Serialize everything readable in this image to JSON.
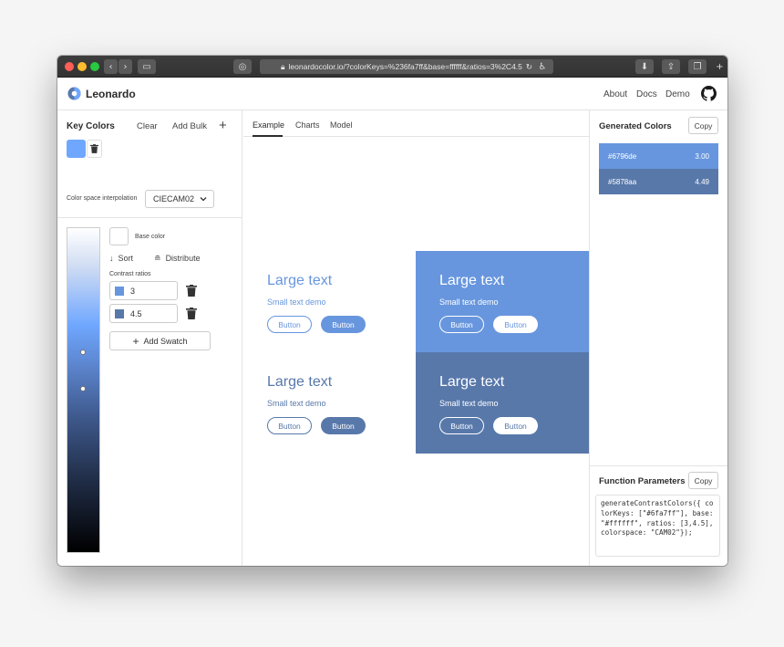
{
  "browser": {
    "url": "leonardocolor.io/?colorKeys=%236fa7ff&base=ffffff&ratios=3%2C4.5"
  },
  "app": {
    "brand": "Leonardo",
    "nav": [
      "About",
      "Docs",
      "Demo"
    ]
  },
  "left_panel": {
    "key_colors_title": "Key Colors",
    "clear_label": "Clear",
    "add_bulk_label": "Add Bulk",
    "add_icon": "+",
    "key_color": "#6fa7ff",
    "interpolation_label": "Color space interpolation",
    "interpolation_value": "CIECAM02",
    "base_color_label": "Base color",
    "sort_label": "Sort",
    "distribute_label": "Distribute",
    "contrast_ratios_label": "Contrast ratios",
    "ratios": [
      {
        "value": "3",
        "color": "#6796de"
      },
      {
        "value": "4.5",
        "color": "#5878aa"
      }
    ],
    "add_swatch_label": "Add Swatch"
  },
  "tabs": [
    "Example",
    "Charts",
    "Model"
  ],
  "demos": [
    {
      "big": "Large text",
      "small": "Small text demo",
      "btn1": "Button",
      "btn2": "Button",
      "bg": "#ffffff",
      "text_color": "#6796de"
    },
    {
      "big": "Large text",
      "small": "Small text demo",
      "btn1": "Button",
      "btn2": "Button",
      "bg": "#6796de",
      "text_color": "#ffffff"
    },
    {
      "big": "Large text",
      "small": "Small text demo",
      "btn1": "Button",
      "btn2": "Button",
      "bg": "#ffffff",
      "text_color": "#5878aa"
    },
    {
      "big": "Large text",
      "small": "Small text demo",
      "btn1": "Button",
      "btn2": "Button",
      "bg": "#5878aa",
      "text_color": "#ffffff"
    }
  ],
  "right_panel": {
    "generated_title": "Generated Colors",
    "copy_label": "Copy",
    "generated": [
      {
        "hex": "#6796de",
        "ratio": "3.00"
      },
      {
        "hex": "#5878aa",
        "ratio": "4.49"
      }
    ],
    "params_title": "Function Parameters",
    "params_copy_label": "Copy",
    "code": "generateContrastColors({ colorKeys: [\"#6fa7ff\"], base: \"#ffffff\", ratios: [3,4.5], colorspace: \"CAM02\"});"
  }
}
